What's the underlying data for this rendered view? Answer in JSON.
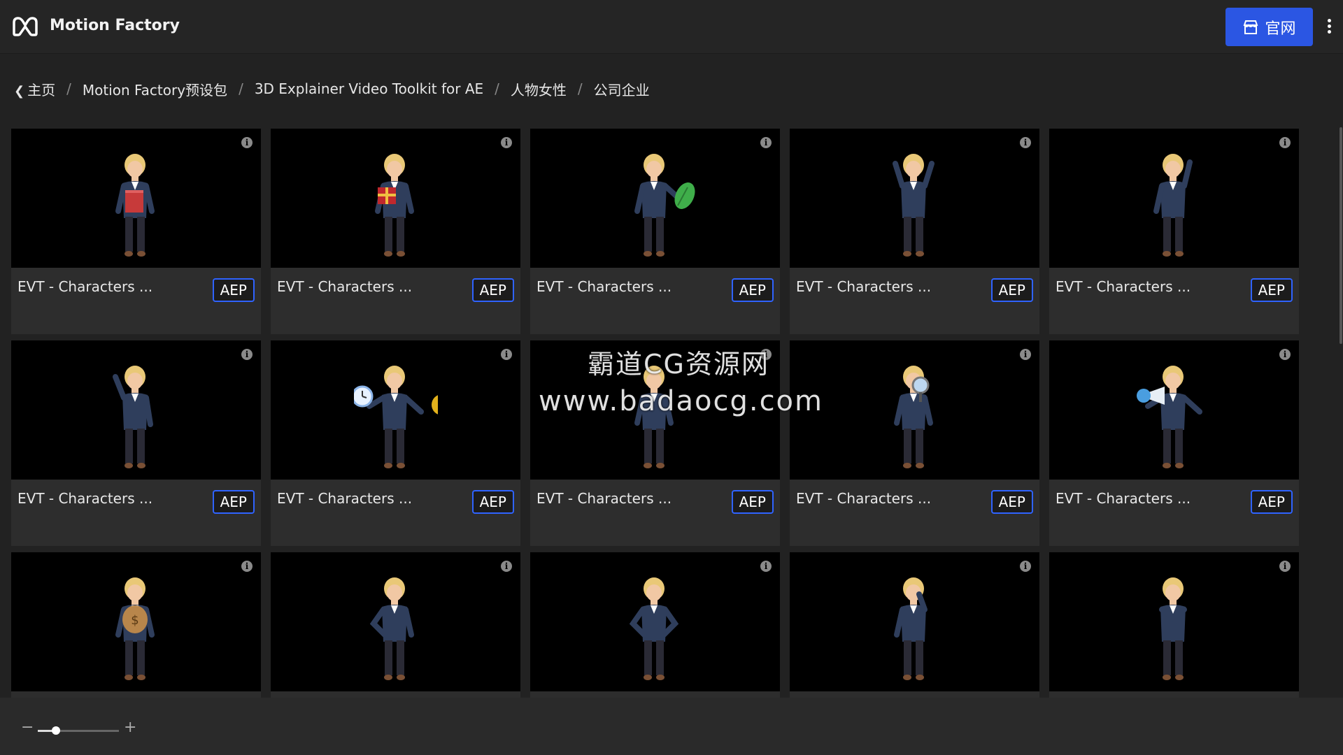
{
  "header": {
    "app_name": "Motion Factory",
    "site_button_label": "官网"
  },
  "breadcrumb": [
    "主页",
    "Motion Factory预设包",
    "3D Explainer Video Toolkit for AE",
    "人物女性",
    "公司企业"
  ],
  "items": [
    {
      "title": "EVT - Characters ...",
      "badge": "AEP",
      "prop": "book"
    },
    {
      "title": "EVT - Characters ...",
      "badge": "AEP",
      "prop": "gift"
    },
    {
      "title": "EVT - Characters ...",
      "badge": "AEP",
      "prop": "leaf"
    },
    {
      "title": "EVT - Characters ...",
      "badge": "AEP",
      "prop": "arms-up"
    },
    {
      "title": "EVT - Characters ...",
      "badge": "AEP",
      "prop": "wave"
    },
    {
      "title": "EVT - Characters ...",
      "badge": "AEP",
      "prop": "point-up"
    },
    {
      "title": "EVT - Characters ...",
      "badge": "AEP",
      "prop": "clock-coin"
    },
    {
      "title": "EVT - Characters ...",
      "badge": "AEP",
      "prop": "none"
    },
    {
      "title": "EVT - Characters ...",
      "badge": "AEP",
      "prop": "magnifier"
    },
    {
      "title": "EVT - Characters ...",
      "badge": "AEP",
      "prop": "megaphone"
    },
    {
      "title": "",
      "badge": "",
      "prop": "money-bag"
    },
    {
      "title": "",
      "badge": "",
      "prop": "hand-hip"
    },
    {
      "title": "",
      "badge": "",
      "prop": "hands-hips"
    },
    {
      "title": "",
      "badge": "",
      "prop": "thinking"
    },
    {
      "title": "",
      "badge": "",
      "prop": "arms-crossed"
    }
  ],
  "zoom": {
    "minus_label": "−",
    "plus_label": "+",
    "level": 0.22
  },
  "watermark": {
    "line1": "霸道CG资源网",
    "line2": "www.badaocg.com"
  },
  "colors": {
    "accent": "#2b56e3",
    "badge_border": "#2f63ff",
    "background": "#222222",
    "card": "#2d2d2d"
  },
  "icons": {
    "logo": "motion-factory-logo-icon",
    "site": "storefront-icon",
    "info": "info-icon",
    "menu": "kebab-menu-icon",
    "back": "chevron-left-icon"
  }
}
